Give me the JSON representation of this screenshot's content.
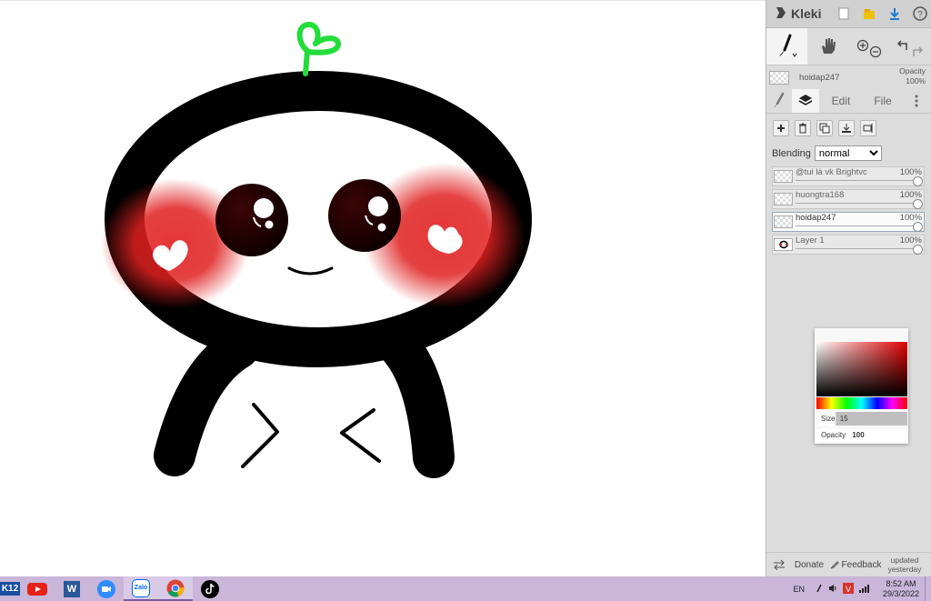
{
  "app": {
    "name": "Kleki"
  },
  "current_layer": {
    "name": "hoidap247",
    "opacity_label": "Opacity",
    "opacity_value": "100%"
  },
  "tabs": [
    {
      "label": "Edit"
    },
    {
      "label": "File"
    }
  ],
  "blending": {
    "label": "Blending",
    "value": "normal"
  },
  "layers": [
    {
      "name": "@tui là vk Brightvc",
      "opacity": "100%"
    },
    {
      "name": "huongtra168",
      "opacity": "100%"
    },
    {
      "name": "hoidap247",
      "opacity": "100%"
    },
    {
      "name": "Layer 1",
      "opacity": "100%"
    }
  ],
  "color_picker": {
    "size_label": "Size",
    "size_value": "15",
    "opacity_label": "Opacity",
    "opacity_value": "100"
  },
  "bottom": {
    "donate": "Donate",
    "feedback": "Feedback",
    "updated": "updated yesterday"
  },
  "taskbar": {
    "k12_label": "K12",
    "zalo_label": "Zalo",
    "word_label": "W",
    "lang": "EN",
    "time": "8:52 AM",
    "date": "29/3/2022"
  },
  "colors": {
    "brush_green": "#22dd3a",
    "blush_red": "#e02020",
    "panel_bg": "#dcdcdc",
    "taskbar_bg": "#c9b6d9"
  }
}
